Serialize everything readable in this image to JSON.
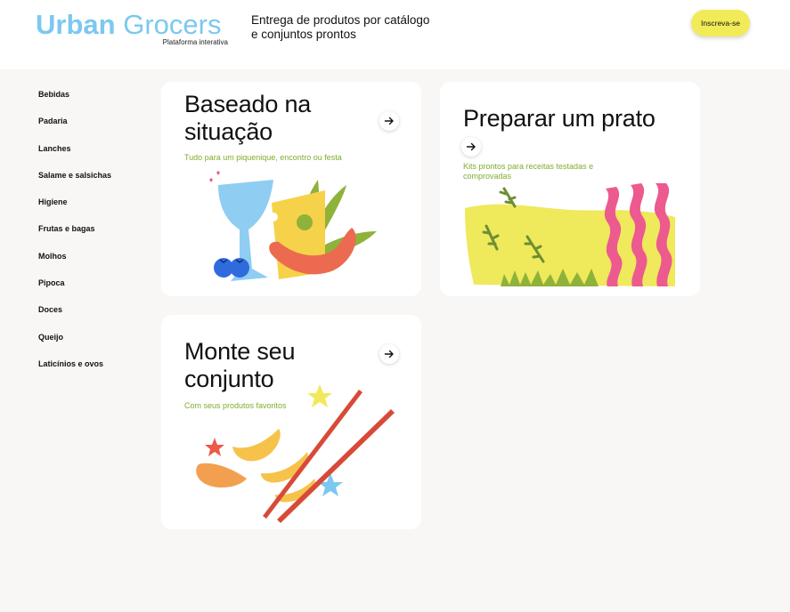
{
  "header": {
    "logo_word1": "Urban",
    "logo_word2": "Grocers",
    "logo_subtitle": "Plataforma interativa",
    "tagline_line1": "Entrega de produtos por catálogo",
    "tagline_line2": "e conjuntos prontos",
    "subscribe_label": "Inscreva-se"
  },
  "sidebar": {
    "items": [
      {
        "label": "Bebidas"
      },
      {
        "label": "Padaria"
      },
      {
        "label": "Lanches"
      },
      {
        "label": "Salame e salsichas"
      },
      {
        "label": "Higiene"
      },
      {
        "label": "Frutas e bagas"
      },
      {
        "label": "Molhos"
      },
      {
        "label": "Pipoca"
      },
      {
        "label": "Doces"
      },
      {
        "label": "Queijo"
      },
      {
        "label": "Laticínios e ovos"
      }
    ]
  },
  "cards": [
    {
      "title_line1": "Baseado na",
      "title_line2": "situação",
      "subtitle_line1": "Tudo para um piquenique, encontro ou festa",
      "icon": "arrow-right-icon"
    },
    {
      "title_line1": "Preparar um prato",
      "subtitle_line1": "Kits prontos para receitas testadas e",
      "subtitle_line2": "comprovadas",
      "icon": "arrow-right-icon"
    },
    {
      "title_line1": "Monte seu",
      "title_line2": "conjunto",
      "subtitle_line1": "Com seus produtos favoritos",
      "icon": "arrow-right-icon"
    }
  ],
  "colors": {
    "logo": "#7cc8f0",
    "accent_button": "#f1eb58",
    "subtitle_green": "#7fac2c",
    "page_bg": "#f8f7f5"
  }
}
